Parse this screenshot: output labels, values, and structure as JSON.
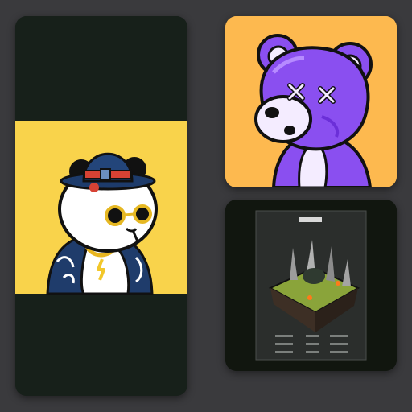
{
  "gallery": {
    "cards": [
      {
        "id": "panda",
        "image": "cartoon-panda-with-fedora-and-sunglasses",
        "colors": {
          "frame": "#17201a",
          "panel": "#f9d34b",
          "fur": "#ffffff",
          "outline": "#111111",
          "hat": "#23457a",
          "hat_band": "#d74234"
        }
      },
      {
        "id": "bear",
        "image": "purple-cartoon-bear-with-x-eyes",
        "colors": {
          "background": "#fdb94f",
          "fur": "#8a4ff0",
          "fur_dark": "#6b2fd8",
          "muzzle": "#f4ecff"
        }
      },
      {
        "id": "map",
        "image": "dark-floating-island-game-map-poster",
        "colors": {
          "frame": "#11160f",
          "poster": "#2b2e2c",
          "grass": "#8aa43a",
          "crystal": "#9c9c9c"
        }
      }
    ]
  }
}
